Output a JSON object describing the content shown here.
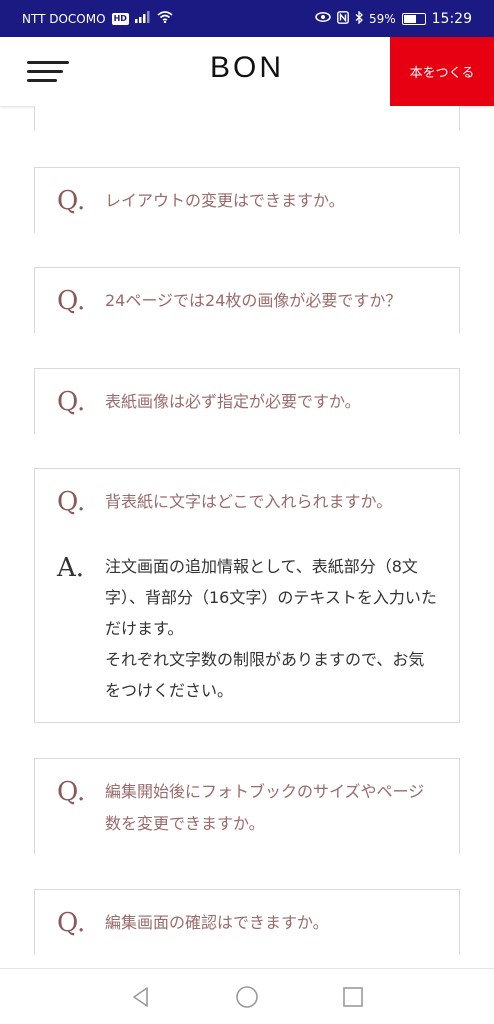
{
  "status_bar": {
    "carrier": "NTT DOCOMO",
    "carrier_badge": "HD",
    "battery_percent": "59%",
    "time": "15:29",
    "battery_level": 0.59
  },
  "header": {
    "logo": "BON",
    "make_book_label": "本をつくる"
  },
  "faq": {
    "q_mark": "Q.",
    "a_mark": "A.",
    "items": [
      {
        "question": "レイアウトの変更はできますか。"
      },
      {
        "question": "24ページでは24枚の画像が必要ですか？"
      },
      {
        "question": "表紙画像は必ず指定が必要ですか。"
      },
      {
        "question": "背表紙に文字はどこで入れられますか。",
        "answer": "注文画面の追加情報として、表紙部分（8文字）、背部分（16文字）のテキストを入力いただけます。\nそれぞれ文字数の制限がありますので、お気をつけください。"
      },
      {
        "question": "編集開始後にフォトブックのサイズやページ数を変更できますか。"
      },
      {
        "question": "編集画面の確認はできますか。"
      }
    ]
  },
  "colors": {
    "status_bar_bg": "#1b1a83",
    "accent_red": "#e60012",
    "question_text": "#9b6b6b"
  }
}
